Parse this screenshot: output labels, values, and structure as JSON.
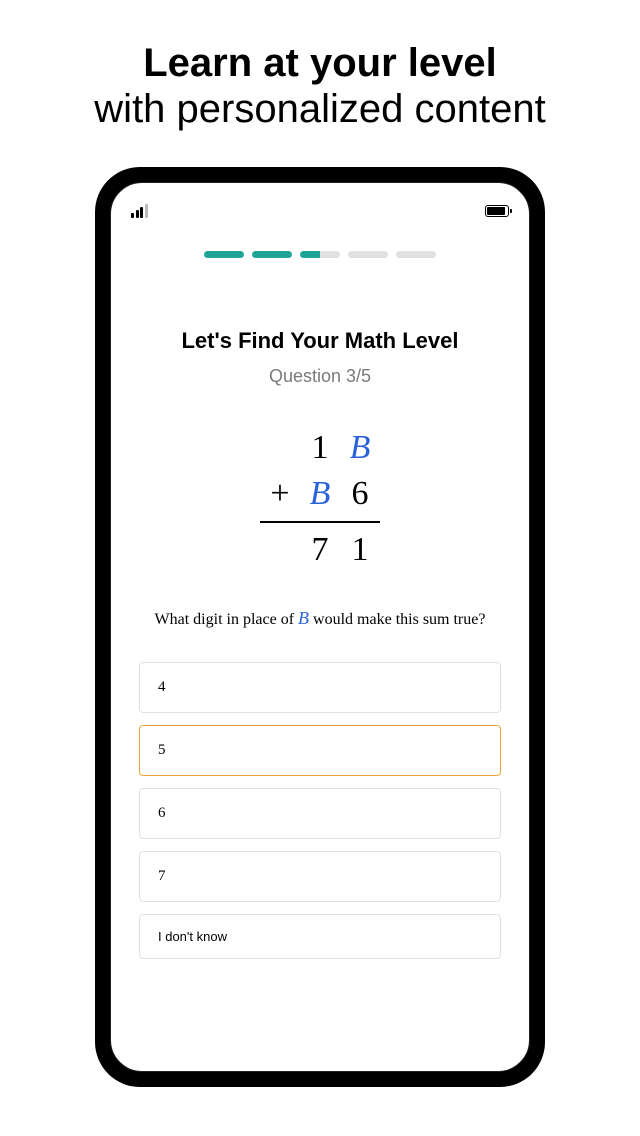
{
  "headline": {
    "bold": "Learn at your level",
    "light": "with personalized content"
  },
  "progress": {
    "total": 5,
    "filled": 2,
    "half": 1
  },
  "quiz": {
    "title": "Let's Find Your Math Level",
    "subtitle": "Question 3/5",
    "problem": {
      "row1": [
        "",
        "1",
        "B"
      ],
      "row2": [
        "+",
        "B",
        "6"
      ],
      "result": [
        "",
        "7",
        "1"
      ],
      "variable": "B"
    },
    "question_prefix": "What digit in place of ",
    "question_var": "B",
    "question_suffix": " would make this sum true?",
    "answers": [
      {
        "label": "4",
        "selected": false
      },
      {
        "label": "5",
        "selected": true
      },
      {
        "label": "6",
        "selected": false
      },
      {
        "label": "7",
        "selected": false
      }
    ],
    "dont_know": "I don't know"
  }
}
